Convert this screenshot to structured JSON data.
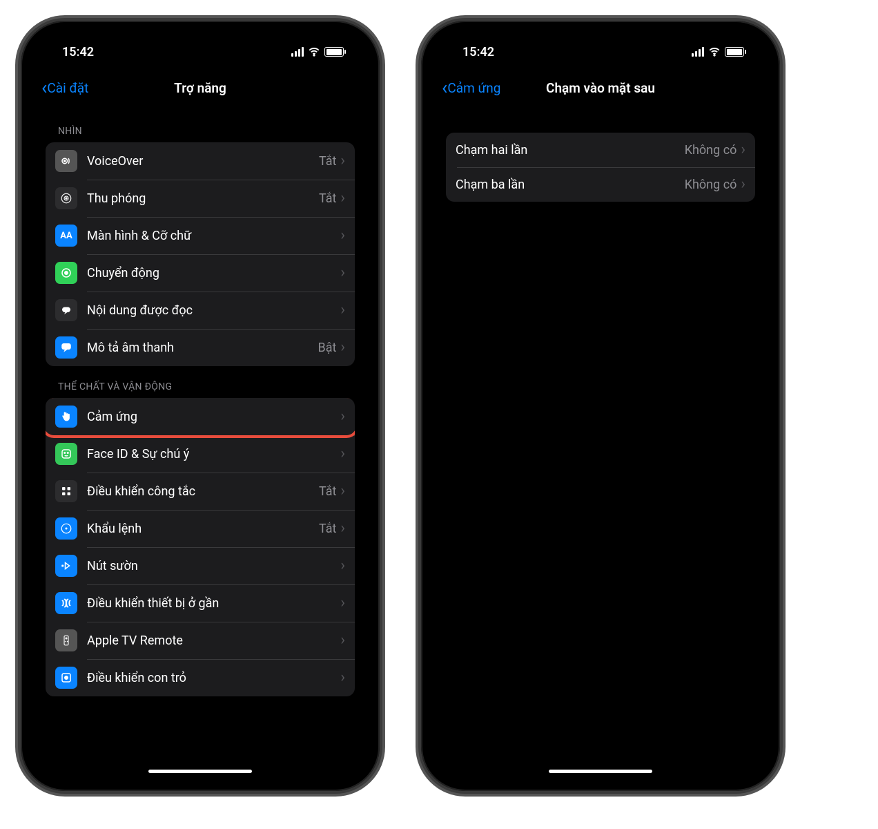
{
  "status": {
    "time": "15:42"
  },
  "left": {
    "back": "Cài đặt",
    "title": "Trợ năng",
    "sections": [
      {
        "header": "NHÌN",
        "rows": [
          {
            "name": "voiceover",
            "label": "VoiceOver",
            "value": "Tắt",
            "iconBg": "bg-gray",
            "iconType": "voiceover"
          },
          {
            "name": "zoom",
            "label": "Thu phóng",
            "value": "Tắt",
            "iconBg": "bg-dark",
            "iconType": "zoom"
          },
          {
            "name": "display-text",
            "label": "Màn hình & Cỡ chữ",
            "value": "",
            "iconBg": "bg-blue",
            "iconType": "aa"
          },
          {
            "name": "motion",
            "label": "Chuyển động",
            "value": "",
            "iconBg": "bg-green",
            "iconType": "motion"
          },
          {
            "name": "spoken-content",
            "label": "Nội dung được đọc",
            "value": "",
            "iconBg": "bg-dark",
            "iconType": "speech"
          },
          {
            "name": "audio-desc",
            "label": "Mô tả âm thanh",
            "value": "Bật",
            "iconBg": "bg-blue",
            "iconType": "bubble"
          }
        ]
      },
      {
        "header": "THỂ CHẤT VÀ VẬN ĐỘNG",
        "rows": [
          {
            "name": "touch",
            "label": "Cảm ứng",
            "value": "",
            "iconBg": "bg-blue",
            "iconType": "hand",
            "highlight": true
          },
          {
            "name": "faceid",
            "label": "Face ID & Sự chú ý",
            "value": "",
            "iconBg": "bg-green2",
            "iconType": "face"
          },
          {
            "name": "switch-control",
            "label": "Điều khiển công tắc",
            "value": "Tắt",
            "iconBg": "bg-dark",
            "iconType": "grid"
          },
          {
            "name": "voice-control",
            "label": "Khẩu lệnh",
            "value": "Tắt",
            "iconBg": "bg-blue",
            "iconType": "mic"
          },
          {
            "name": "side-button",
            "label": "Nút sườn",
            "value": "",
            "iconBg": "bg-blue",
            "iconType": "side"
          },
          {
            "name": "nearby-control",
            "label": "Điều khiển thiết bị ở gần",
            "value": "",
            "iconBg": "bg-blue",
            "iconType": "waves"
          },
          {
            "name": "apple-tv",
            "label": "Apple TV Remote",
            "value": "",
            "iconBg": "bg-gray",
            "iconType": "remote"
          },
          {
            "name": "pointer-control",
            "label": "Điều khiển con trỏ",
            "value": "",
            "iconBg": "bg-blue",
            "iconType": "pointer"
          }
        ]
      }
    ]
  },
  "right": {
    "back": "Cảm ứng",
    "title": "Chạm vào mặt sau",
    "rows": [
      {
        "name": "double-tap",
        "label": "Chạm hai lần",
        "value": "Không có"
      },
      {
        "name": "triple-tap",
        "label": "Chạm ba lần",
        "value": "Không có"
      }
    ]
  }
}
